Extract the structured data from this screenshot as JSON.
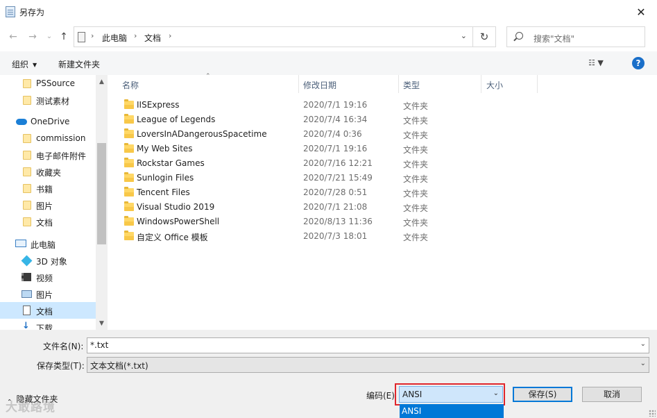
{
  "window": {
    "title": "另存为",
    "close_glyph": "✕"
  },
  "address": {
    "back_glyph": "←",
    "forward_glyph": "→",
    "recent_glyph": "⌄",
    "up_glyph": "↑",
    "crumbs": [
      "此电脑",
      "文档"
    ],
    "sep_glyph": "›",
    "dropdown_glyph": "⌄",
    "refresh_glyph": "↻",
    "search_placeholder": "搜索\"文档\""
  },
  "toolbar": {
    "organize_label": "组织",
    "organize_caret": "▼",
    "new_folder_label": "新建文件夹",
    "view_glyph": "☷  ▼",
    "help_glyph": "?"
  },
  "navpane": {
    "items": [
      {
        "label": "PSSource",
        "icon": "folder-icon"
      },
      {
        "label": "测试素材",
        "icon": "folder-icon"
      },
      {
        "label": "OneDrive",
        "icon": "onedrive-cloud-icon"
      },
      {
        "label": "commission",
        "icon": "folder-icon"
      },
      {
        "label": "电子邮件附件",
        "icon": "folder-icon"
      },
      {
        "label": "收藏夹",
        "icon": "folder-icon"
      },
      {
        "label": "书籍",
        "icon": "folder-icon"
      },
      {
        "label": "图片",
        "icon": "folder-icon"
      },
      {
        "label": "文档",
        "icon": "folder-icon"
      },
      {
        "label": "此电脑",
        "icon": "computer-icon"
      },
      {
        "label": "3D 对象",
        "icon": "3d-objects-icon"
      },
      {
        "label": "视频",
        "icon": "video-icon"
      },
      {
        "label": "图片",
        "icon": "pictures-icon"
      },
      {
        "label": "文档",
        "icon": "documents-icon",
        "selected": true
      },
      {
        "label": "下载",
        "icon": "download-icon"
      }
    ],
    "scroll_up_glyph": "▲",
    "scroll_down_glyph": "▼"
  },
  "filelist": {
    "columns": {
      "name": "名称",
      "date": "修改日期",
      "type": "类型",
      "size": "大小"
    },
    "sort_glyph": "⌃",
    "rows": [
      {
        "name": "IISExpress",
        "date": "2020/7/1 19:16",
        "type": "文件夹"
      },
      {
        "name": "League of Legends",
        "date": "2020/7/4 16:34",
        "type": "文件夹"
      },
      {
        "name": "LoversInADangerousSpacetime",
        "date": "2020/7/4 0:36",
        "type": "文件夹"
      },
      {
        "name": "My Web Sites",
        "date": "2020/7/1 19:16",
        "type": "文件夹"
      },
      {
        "name": "Rockstar Games",
        "date": "2020/7/16 12:21",
        "type": "文件夹"
      },
      {
        "name": "Sunlogin Files",
        "date": "2020/7/21 15:49",
        "type": "文件夹"
      },
      {
        "name": "Tencent Files",
        "date": "2020/7/28 0:51",
        "type": "文件夹"
      },
      {
        "name": "Visual Studio 2019",
        "date": "2020/7/1 21:08",
        "type": "文件夹"
      },
      {
        "name": "WindowsPowerShell",
        "date": "2020/8/13 11:36",
        "type": "文件夹"
      },
      {
        "name": "自定义 Office 模板",
        "date": "2020/7/3 18:01",
        "type": "文件夹"
      }
    ]
  },
  "form": {
    "filename_label": "文件名(N):",
    "filename_value": "*.txt",
    "filetype_label": "保存类型(T):",
    "filetype_value": "文本文档(*.txt)",
    "dropdown_glyph": "⌄",
    "hide_folders_label": "隐藏文件夹",
    "hide_folders_glyph": "⌄",
    "encoding_label": "编码(E)",
    "encoding_value": "ANSI",
    "encoding_option_highlighted": "ANSI",
    "save_button": "保存(S)",
    "cancel_button": "取消"
  },
  "watermark": "大敢路境",
  "colors": {
    "accent": "#0078d7",
    "highlight_border": "#e0262c",
    "selected_nav": "#cde8ff",
    "folder": "#ffd867"
  }
}
